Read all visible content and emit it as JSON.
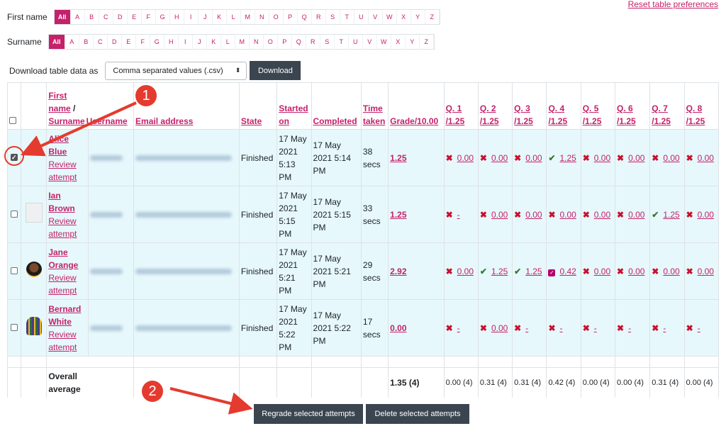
{
  "reset_link": "Reset table preferences",
  "firstname_filter": {
    "label": "First name",
    "all": "All",
    "letters": [
      "A",
      "B",
      "C",
      "D",
      "E",
      "F",
      "G",
      "H",
      "I",
      "J",
      "K",
      "L",
      "M",
      "N",
      "O",
      "P",
      "Q",
      "R",
      "S",
      "T",
      "U",
      "V",
      "W",
      "X",
      "Y",
      "Z"
    ]
  },
  "surname_filter": {
    "label": "Surname",
    "all": "All",
    "letters": [
      "A",
      "B",
      "C",
      "D",
      "E",
      "F",
      "G",
      "H",
      "I",
      "J",
      "K",
      "L",
      "M",
      "N",
      "O",
      "P",
      "Q",
      "R",
      "S",
      "T",
      "U",
      "V",
      "W",
      "X",
      "Y",
      "Z"
    ]
  },
  "download": {
    "label": "Download table data as",
    "format": "Comma separated values (.csv)",
    "button": "Download"
  },
  "columns": {
    "firstname": "First",
    "firstname2": "name",
    "slash": "/",
    "surname": "Surname",
    "username": "Username",
    "email": "Email address",
    "state": "State",
    "started": "Started",
    "started2": "on",
    "completed": "Completed",
    "timetaken": "Time",
    "timetaken2": "taken",
    "grade": "Grade/10.00",
    "questions": [
      {
        "q": "Q. 1",
        "max": "/1.25"
      },
      {
        "q": "Q. 2",
        "max": "/1.25"
      },
      {
        "q": "Q. 3",
        "max": "/1.25"
      },
      {
        "q": "Q. 4",
        "max": "/1.25"
      },
      {
        "q": "Q. 5",
        "max": "/1.25"
      },
      {
        "q": "Q. 6",
        "max": "/1.25"
      },
      {
        "q": "Q. 7",
        "max": "/1.25"
      },
      {
        "q": "Q. 8",
        "max": "/1.25"
      }
    ]
  },
  "rows": [
    {
      "first": "Alice",
      "last": "Blue",
      "review": "Review attempt",
      "state": "Finished",
      "started": [
        "17 May",
        "2021",
        "5:13",
        "PM"
      ],
      "completed": [
        "17 May",
        "2021 5:14",
        "PM"
      ],
      "time": [
        "38",
        "secs"
      ],
      "grade": "1.25",
      "marks": [
        [
          "x",
          "0.00"
        ],
        [
          "x",
          "0.00"
        ],
        [
          "x",
          "0.00"
        ],
        [
          "ok",
          "1.25"
        ],
        [
          "x",
          "0.00"
        ],
        [
          "x",
          "0.00"
        ],
        [
          "x",
          "0.00"
        ],
        [
          "x",
          "0.00"
        ]
      ]
    },
    {
      "first": "Ian",
      "last": "Brown",
      "review": "Review attempt",
      "state": "Finished",
      "started": [
        "17 May",
        "2021",
        "5:15",
        "PM"
      ],
      "completed": [
        "17 May",
        "2021 5:15",
        "PM"
      ],
      "time": [
        "33",
        "secs"
      ],
      "grade": "1.25",
      "marks": [
        [
          "x",
          "-"
        ],
        [
          "x",
          "0.00"
        ],
        [
          "x",
          "0.00"
        ],
        [
          "x",
          "0.00"
        ],
        [
          "x",
          "0.00"
        ],
        [
          "x",
          "0.00"
        ],
        [
          "ok",
          "1.25"
        ],
        [
          "x",
          "0.00"
        ]
      ]
    },
    {
      "first": "Jane",
      "last": "Orange",
      "review": "Review attempt",
      "state": "Finished",
      "started": [
        "17 May",
        "2021",
        "5:21",
        "PM"
      ],
      "completed": [
        "17 May",
        "2021 5:21",
        "PM"
      ],
      "time": [
        "29",
        "secs"
      ],
      "grade": "2.92",
      "marks": [
        [
          "x",
          "0.00"
        ],
        [
          "ok",
          "1.25"
        ],
        [
          "ok",
          "1.25"
        ],
        [
          "part",
          "0.42"
        ],
        [
          "x",
          "0.00"
        ],
        [
          "x",
          "0.00"
        ],
        [
          "x",
          "0.00"
        ],
        [
          "x",
          "0.00"
        ]
      ]
    },
    {
      "first": "Bernard",
      "last": "White",
      "review": "Review attempt",
      "state": "Finished",
      "started": [
        "17 May",
        "2021",
        "5:22",
        "PM"
      ],
      "completed": [
        "17 May",
        "2021 5:22",
        "PM"
      ],
      "time": [
        "17",
        "secs"
      ],
      "grade": "0.00",
      "marks": [
        [
          "x",
          "-"
        ],
        [
          "x",
          "0.00"
        ],
        [
          "x",
          "-"
        ],
        [
          "x",
          "-"
        ],
        [
          "x",
          "-"
        ],
        [
          "x",
          "-"
        ],
        [
          "x",
          "-"
        ],
        [
          "x",
          "-"
        ]
      ]
    }
  ],
  "average": {
    "label1": "Overall",
    "label2": "average",
    "grade": "1.35 (4)",
    "qs": [
      "0.00 (4)",
      "0.31 (4)",
      "0.31 (4)",
      "0.42 (4)",
      "0.00 (4)",
      "0.00 (4)",
      "0.31 (4)",
      "0.00 (4)"
    ]
  },
  "actions": {
    "regrade": "Regrade selected attempts",
    "delete": "Delete selected attempts"
  },
  "callouts": [
    "1",
    "2"
  ]
}
